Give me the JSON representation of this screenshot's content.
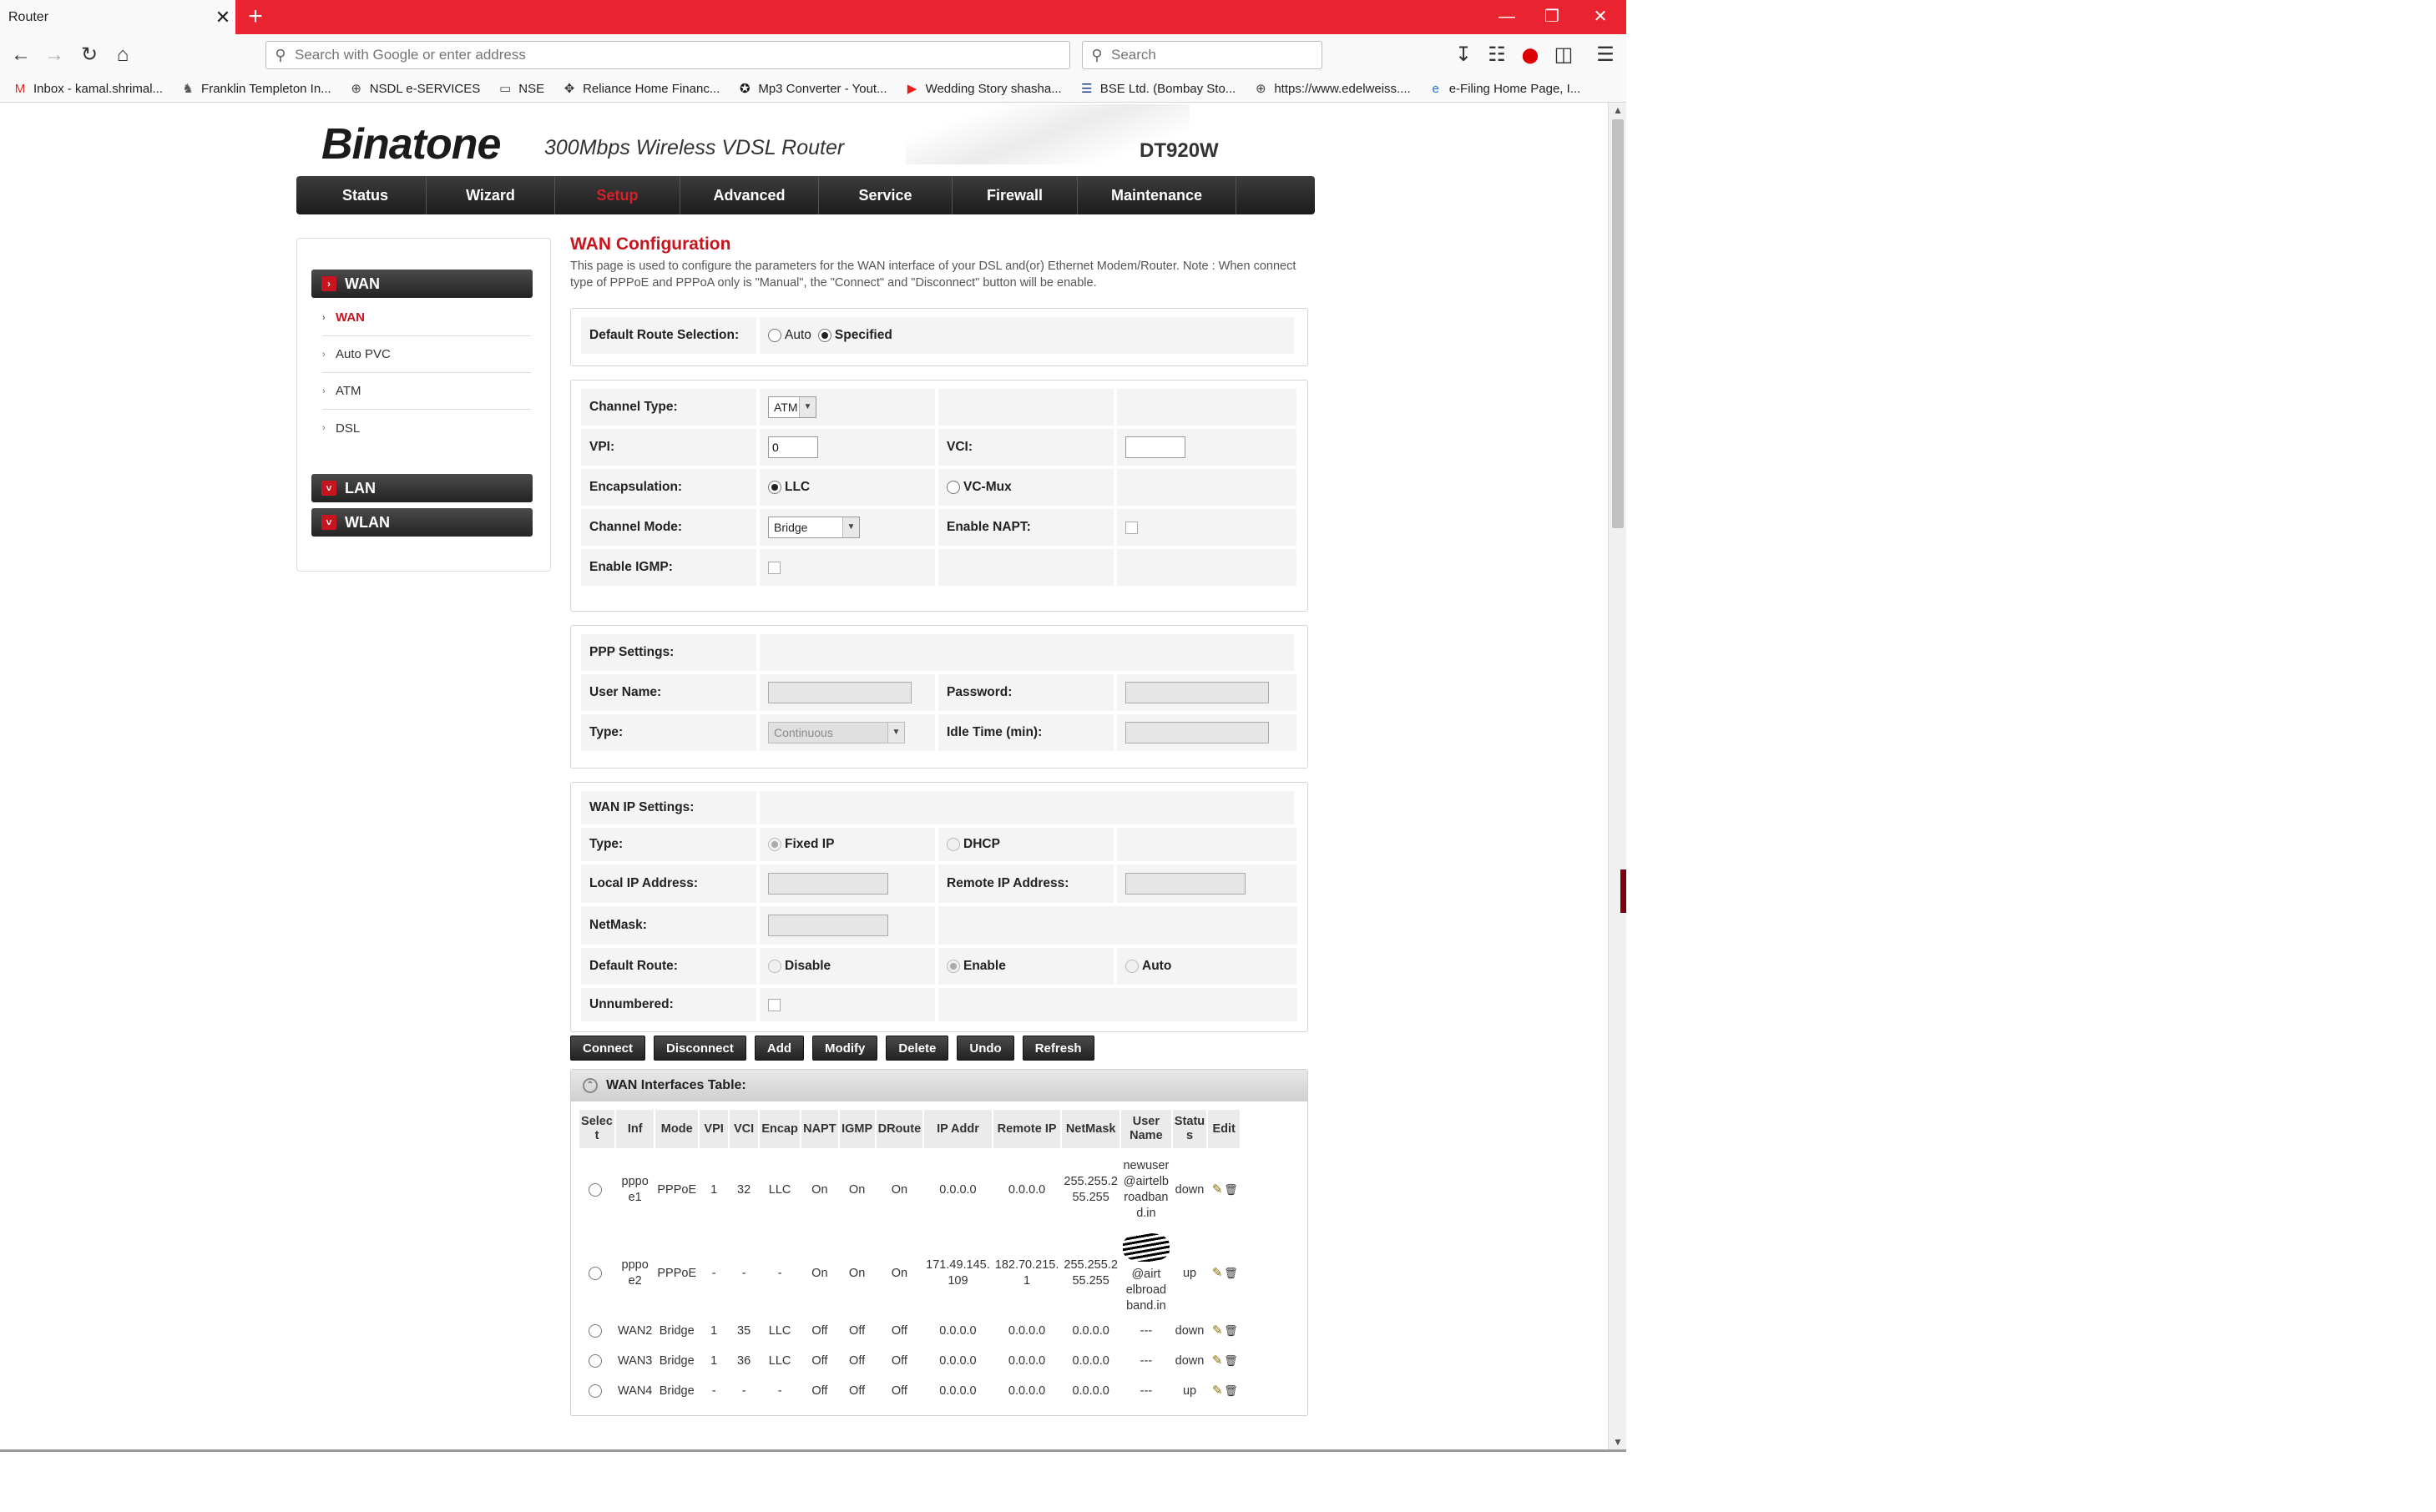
{
  "browser": {
    "tab_title": "Router",
    "tab_close": "✕",
    "new_tab": "+",
    "url_placeholder": "Search with Google or enter address",
    "search_placeholder": "Search",
    "bookmarks": [
      {
        "label": "Inbox - kamal.shrimal...",
        "icon": "gmail-icon",
        "glyph": "M",
        "color": "#d93025"
      },
      {
        "label": "Franklin Templeton In...",
        "icon": "franklin-icon",
        "glyph": "♞",
        "color": "#555555"
      },
      {
        "label": "NSDL e-SERVICES",
        "icon": "globe-icon",
        "glyph": "⊕",
        "color": "#444444"
      },
      {
        "label": "NSE",
        "icon": "folder-icon",
        "glyph": "▭",
        "color": "#444444"
      },
      {
        "label": "Reliance Home Financ...",
        "icon": "reliance-icon",
        "glyph": "✥",
        "color": "#333333"
      },
      {
        "label": "Mp3 Converter - Yout...",
        "icon": "mp3-icon",
        "glyph": "✪",
        "color": "#111111"
      },
      {
        "label": "Wedding Story shasha...",
        "icon": "youtube-icon",
        "glyph": "▶",
        "color": "#e62117"
      },
      {
        "label": "BSE Ltd. (Bombay Sto...",
        "icon": "bse-icon",
        "glyph": "☰",
        "color": "#1a3c8c"
      },
      {
        "label": "https://www.edelweiss....",
        "icon": "globe-icon",
        "glyph": "⊕",
        "color": "#444444"
      },
      {
        "label": "e-Filing Home Page, I...",
        "icon": "ie-icon",
        "glyph": "e",
        "color": "#1e6fd9"
      }
    ]
  },
  "router": {
    "brand": "Binatone",
    "description": "300Mbps Wireless VDSL Router",
    "model": "DT920W",
    "nav": [
      "Status",
      "Wizard",
      "Setup",
      "Advanced",
      "Service",
      "Firewall",
      "Maintenance"
    ],
    "sidebar": {
      "wan_head": "WAN",
      "wan_items": [
        "WAN",
        "Auto PVC",
        "ATM",
        "DSL"
      ],
      "lan_head": "LAN",
      "wlan_head": "WLAN"
    },
    "page_title": "WAN Configuration",
    "page_desc": "This page is used to configure the parameters for the WAN interface of your DSL and(or) Ethernet Modem/Router. Note : When connect type of PPPoE and PPPoA only is \"Manual\", the \"Connect\" and \"Disconnect\" button will be enable.",
    "default_route": {
      "label": "Default Route Selection:",
      "opt_auto": "Auto",
      "opt_specified": "Specified"
    },
    "channel": {
      "type_label": "Channel Type:",
      "type_value": "ATM",
      "vpi_label": "VPI:",
      "vpi_value": "0",
      "vci_label": "VCI:",
      "vci_value": "",
      "encap_label": "Encapsulation:",
      "encap_llc": "LLC",
      "encap_vcmux": "VC-Mux",
      "mode_label": "Channel Mode:",
      "mode_value": "Bridge",
      "napt_label": "Enable NAPT:",
      "igmp_label": "Enable IGMP:"
    },
    "ppp": {
      "title": "PPP Settings:",
      "user_label": "User Name:",
      "pass_label": "Password:",
      "type_label": "Type:",
      "type_value": "Continuous",
      "idle_label": "Idle Time (min):"
    },
    "wanip": {
      "title": "WAN IP Settings:",
      "type_label": "Type:",
      "fixed": "Fixed IP",
      "dhcp": "DHCP",
      "local_label": "Local IP Address:",
      "remote_label": "Remote IP Address:",
      "mask_label": "NetMask:",
      "droute_label": "Default Route:",
      "disable": "Disable",
      "enable": "Enable",
      "auto": "Auto",
      "unnum_label": "Unnumbered:"
    },
    "buttons": [
      "Connect",
      "Disconnect",
      "Add",
      "Modify",
      "Delete",
      "Undo",
      "Refresh"
    ],
    "table": {
      "title": "WAN Interfaces Table:",
      "headers": [
        "Selec\nt",
        "Inf",
        "Mode",
        "VPI",
        "VCI",
        "Encap",
        "NAPT",
        "IGMP",
        "DRoute",
        "IP Addr",
        "Remote IP",
        "NetMask",
        "User\nName",
        "Statu\ns",
        "Edit"
      ],
      "rows": [
        {
          "inf": "pppo\ne1",
          "mode": "PPPoE",
          "vpi": "1",
          "vci": "32",
          "encap": "LLC",
          "napt": "On",
          "igmp": "On",
          "droute": "On",
          "ip": "0.0.0.0",
          "remote": "0.0.0.0",
          "mask": "255.255.2\n55.255",
          "user": "newuser\n@airtelb\nroadban\nd.in",
          "status": "down"
        },
        {
          "inf": "pppo\ne2",
          "mode": "PPPoE",
          "vpi": "-",
          "vci": "-",
          "encap": "-",
          "napt": "On",
          "igmp": "On",
          "droute": "On",
          "ip": "171.49.145.\n109",
          "remote": "182.70.215.\n1",
          "mask": "255.255.2\n55.255",
          "user": "@airt\nelbroad\nband.in",
          "status": "up"
        },
        {
          "inf": "WAN2",
          "mode": "Bridge",
          "vpi": "1",
          "vci": "35",
          "encap": "LLC",
          "napt": "Off",
          "igmp": "Off",
          "droute": "Off",
          "ip": "0.0.0.0",
          "remote": "0.0.0.0",
          "mask": "0.0.0.0",
          "user": "---",
          "status": "down"
        },
        {
          "inf": "WAN3",
          "mode": "Bridge",
          "vpi": "1",
          "vci": "36",
          "encap": "LLC",
          "napt": "Off",
          "igmp": "Off",
          "droute": "Off",
          "ip": "0.0.0.0",
          "remote": "0.0.0.0",
          "mask": "0.0.0.0",
          "user": "---",
          "status": "down"
        },
        {
          "inf": "WAN4",
          "mode": "Bridge",
          "vpi": "-",
          "vci": "-",
          "encap": "-",
          "napt": "Off",
          "igmp": "Off",
          "droute": "Off",
          "ip": "0.0.0.0",
          "remote": "0.0.0.0",
          "mask": "0.0.0.0",
          "user": "---",
          "status": "up"
        }
      ]
    }
  }
}
